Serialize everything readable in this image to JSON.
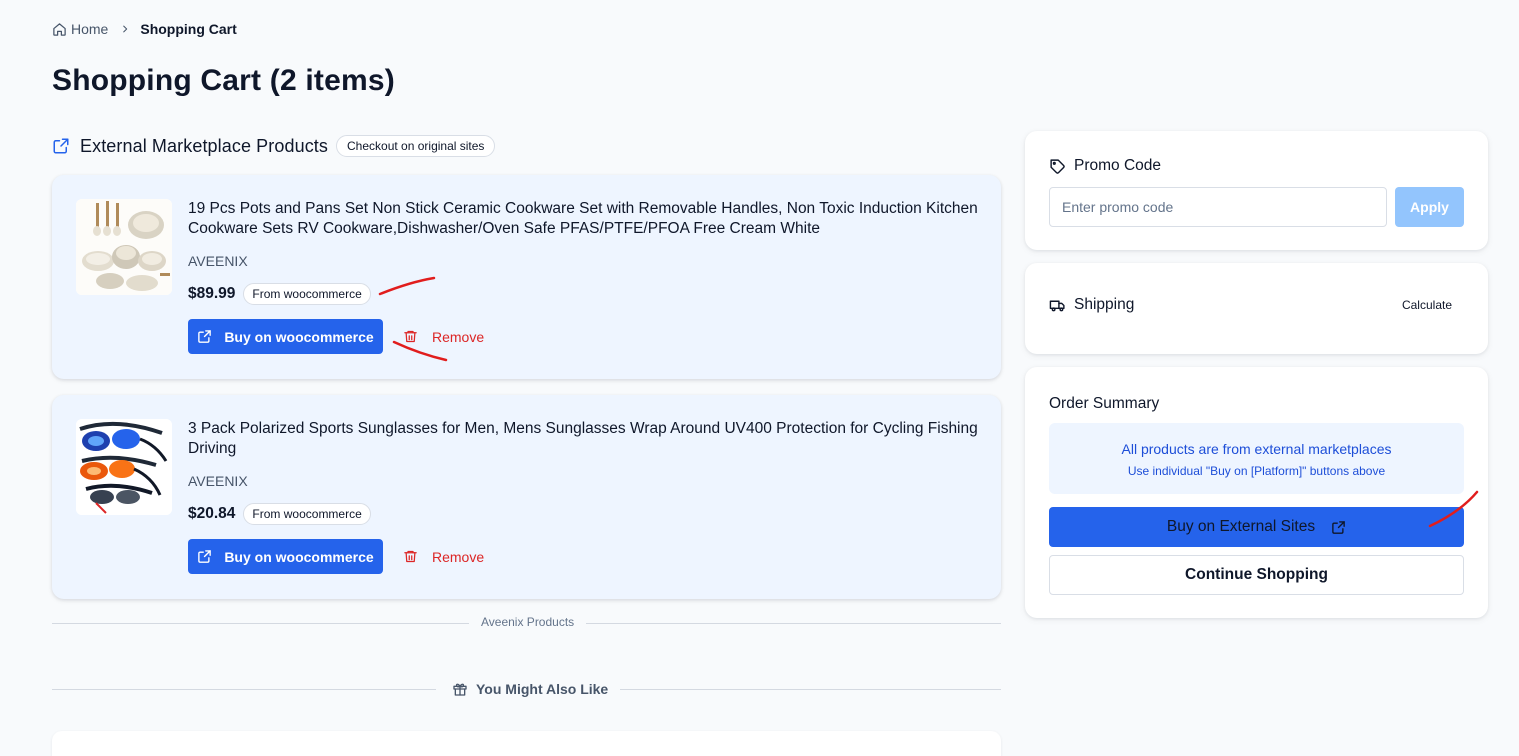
{
  "breadcrumb": {
    "home": "Home",
    "current": "Shopping Cart"
  },
  "page_title": "Shopping Cart (2 items)",
  "section": {
    "title": "External Marketplace Products",
    "badge": "Checkout on original sites"
  },
  "products": [
    {
      "title": "19 Pcs Pots and Pans Set Non Stick Ceramic Cookware Set with Removable Handles, Non Toxic Induction Kitchen Cookware Sets RV Cookware,Dishwasher/Oven Safe PFAS/PTFE/PFOA Free Cream White",
      "brand": "AVEENIX",
      "price": "$89.99",
      "source": "From woocommerce",
      "buy_label": "Buy on woocommerce",
      "remove_label": "Remove"
    },
    {
      "title": "3 Pack Polarized Sports Sunglasses for Men, Mens Sunglasses Wrap Around UV400 Protection for Cycling Fishing Driving",
      "brand": "AVEENIX",
      "price": "$20.84",
      "source": "From woocommerce",
      "buy_label": "Buy on woocommerce",
      "remove_label": "Remove"
    }
  ],
  "divider_label": "Aveenix Products",
  "also_like": "You Might Also Like",
  "promo": {
    "title": "Promo Code",
    "placeholder": "Enter promo code",
    "apply_label": "Apply"
  },
  "shipping": {
    "title": "Shipping",
    "calculate_label": "Calculate"
  },
  "summary": {
    "title": "Order Summary",
    "notice_title": "All products are from external marketplaces",
    "notice_sub": "Use individual \"Buy on [Platform]\" buttons above",
    "buy_external_label": "Buy on External Sites",
    "continue_label": "Continue Shopping"
  },
  "colors": {
    "primary": "#2563eb",
    "danger": "#dc2626",
    "card_bg": "#eef5ff",
    "page_bg": "#f8fafc",
    "annotation": "#e11d1d"
  },
  "icons": [
    "home-icon",
    "chevron-right-icon",
    "external-link-icon",
    "trash-icon",
    "tag-icon",
    "truck-icon",
    "gift-icon"
  ]
}
